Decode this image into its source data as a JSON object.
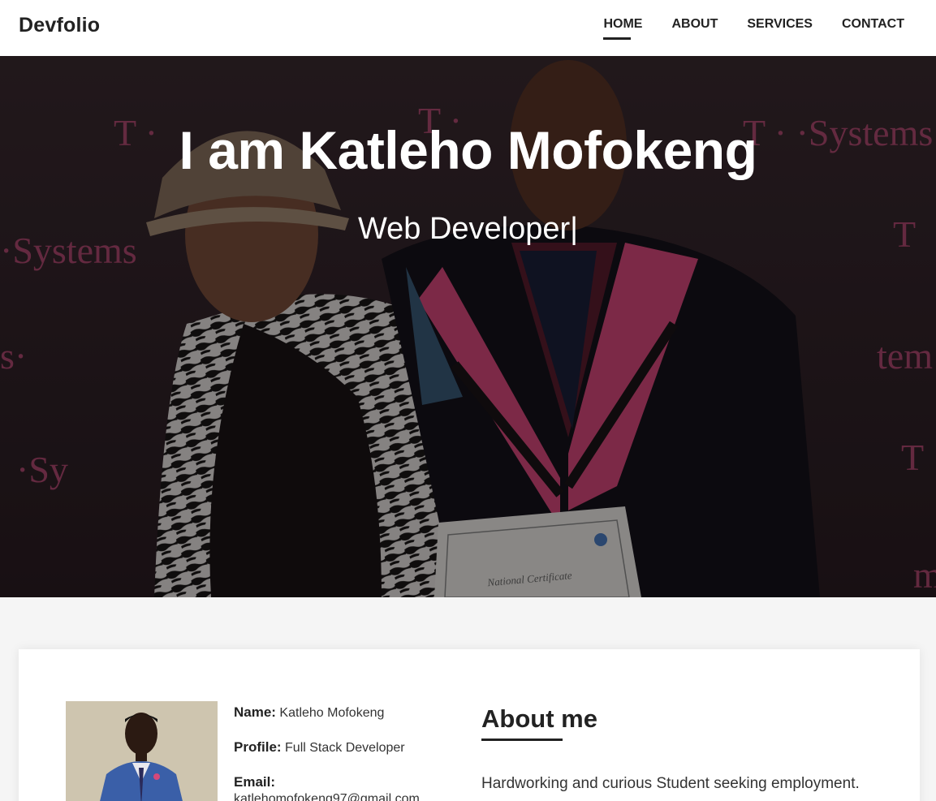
{
  "navbar": {
    "brand": "Devfolio",
    "items": [
      {
        "label": "HOME",
        "active": true
      },
      {
        "label": "ABOUT",
        "active": false
      },
      {
        "label": "SERVICES",
        "active": false
      },
      {
        "label": "CONTACT",
        "active": false
      }
    ]
  },
  "hero": {
    "title": "I am Katleho Mofokeng",
    "subtitle": "Web Developer",
    "cursor": "|"
  },
  "about": {
    "name_label": "Name:",
    "name_value": "Katleho Mofokeng",
    "profile_label": "Profile:",
    "profile_value": "Full Stack Developer",
    "email_label": "Email:",
    "email_value": "katlehomofokeng97@gmail.com",
    "heading": "About me",
    "text": "Hardworking and curious Student seeking employment."
  },
  "colors": {
    "accent": "#222222",
    "graduation_stole": "#d6487a",
    "background": "#f5f5f5"
  }
}
